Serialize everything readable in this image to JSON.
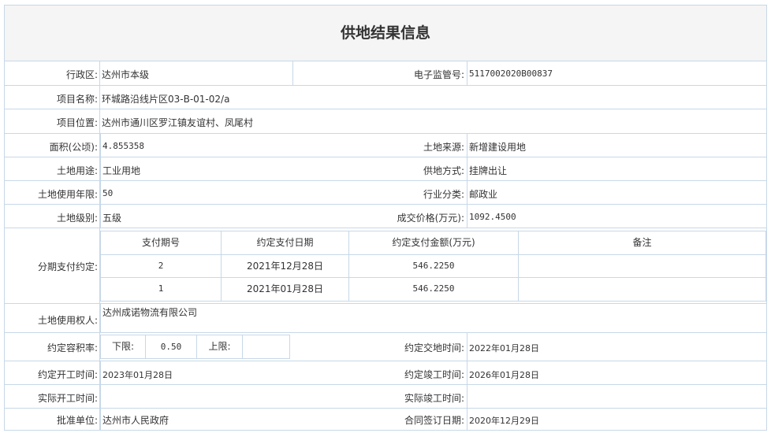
{
  "title": "供地结果信息",
  "rows": {
    "district": {
      "label": "行政区:",
      "value": "达州市本级"
    },
    "supervision_no": {
      "label": "电子监管号:",
      "value": "5117002020B00837"
    },
    "project_name": {
      "label": "项目名称:",
      "value": "环城路沿线片区03-B-01-02/a"
    },
    "project_location": {
      "label": "项目位置:",
      "value": "达州市通川区罗江镇友谊村、凤尾村"
    },
    "area": {
      "label": "面积(公顷):",
      "value": "4.855358"
    },
    "land_source": {
      "label": "土地来源:",
      "value": "新增建设用地"
    },
    "land_use": {
      "label": "土地用途:",
      "value": "工业用地"
    },
    "supply_method": {
      "label": "供地方式:",
      "value": "挂牌出让"
    },
    "use_years": {
      "label": "土地使用年限:",
      "value": "50"
    },
    "industry": {
      "label": "行业分类:",
      "value": "邮政业"
    },
    "land_grade": {
      "label": "土地级别:",
      "value": "五级"
    },
    "price": {
      "label": "成交价格(万元):",
      "value": "1092.4500"
    },
    "installment": {
      "label": "分期支付约定:",
      "headers": [
        "支付期号",
        "约定支付日期",
        "约定支付金额(万元)",
        "备注"
      ],
      "rows": [
        [
          "2",
          "2021年12月28日",
          "546.2250",
          ""
        ],
        [
          "1",
          "2021年01月28日",
          "546.2250",
          ""
        ]
      ]
    },
    "land_user": {
      "label": "土地使用权人:",
      "value": "达州成诺物流有限公司"
    },
    "far": {
      "label": "约定容积率:",
      "lower_label": "下限:",
      "lower_value": "0.50",
      "upper_label": "上限:",
      "upper_value": ""
    },
    "handover_time": {
      "label": "约定交地时间:",
      "value": "2022年01月28日"
    },
    "start_time": {
      "label": "约定开工时间:",
      "value": "2023年01月28日"
    },
    "complete_time": {
      "label": "约定竣工时间:",
      "value": "2026年01月28日"
    },
    "actual_start": {
      "label": "实际开工时间:",
      "value": ""
    },
    "actual_complete": {
      "label": "实际竣工时间:",
      "value": ""
    },
    "approver": {
      "label": "批准单位:",
      "value": "达州市人民政府"
    },
    "contract_date": {
      "label": "合同签订日期:",
      "value": "2020年12月29日"
    }
  },
  "colors": {
    "border": "#c7d8e8",
    "title_bg": "#f5f5f5",
    "text": "#333333"
  }
}
